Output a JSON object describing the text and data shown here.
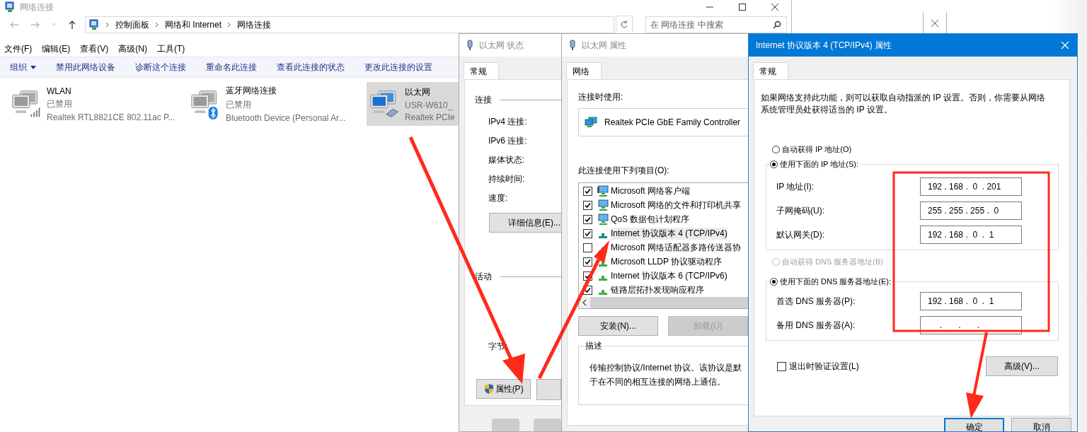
{
  "explorer": {
    "title": "网络连接",
    "breadcrumb": [
      "控制面板",
      "网络和 Internet",
      "网络连接"
    ],
    "search": {
      "placeholder": "在 网络连接 中搜索"
    },
    "menu": [
      "文件(F)",
      "编辑(E)",
      "查看(V)",
      "高级(N)",
      "工具(T)"
    ],
    "commands": [
      {
        "label": "组织",
        "kind": "menu"
      },
      {
        "label": "禁用此网络设备",
        "kind": "command"
      },
      {
        "label": "诊断这个连接",
        "kind": "command"
      },
      {
        "label": "重命名此连接",
        "kind": "command"
      },
      {
        "label": "查看此连接的状态",
        "kind": "command"
      },
      {
        "label": "更改此连接的设置",
        "kind": "command"
      }
    ],
    "connections": [
      {
        "name": "WLAN",
        "status": "已禁用",
        "device": "Realtek RTL8821CE 802.11ac P...",
        "kind": "wifi",
        "selected": false
      },
      {
        "name": "蓝牙网络连接",
        "status": "已禁用",
        "device": "Bluetooth Device (Personal Ar...",
        "kind": "bluetooth",
        "selected": false
      },
      {
        "name": "以太网",
        "status": "USR-W610_",
        "device": "Realtek PCIe",
        "kind": "ethernet",
        "selected": true
      }
    ]
  },
  "status_dialog": {
    "title": "以太网 状态",
    "tabs": [
      {
        "label": "常规",
        "selected": true
      }
    ],
    "connection_group": "连接",
    "fields": [
      "IPv4 连接:",
      "IPv6 连接:",
      "媒体状态:",
      "持续时间:",
      "速度:"
    ],
    "details_button": "详细信息(E)...",
    "activity_group": "活动",
    "bytes_label": "字节:",
    "properties_button": "属性(P)"
  },
  "properties_dialog": {
    "title": "以太网 属性",
    "tabs": [
      {
        "label": "网络",
        "selected": true
      }
    ],
    "connect_using_label": "连接时使用:",
    "adapter": "Realtek PCIe GbE Family Controller",
    "items_label": "此连接使用下列项目(O):",
    "items": [
      {
        "label": "Microsoft 网络客户端",
        "kind": "client",
        "checked": true,
        "selected": false
      },
      {
        "label": "Microsoft 网络的文件和打印机共享",
        "kind": "service",
        "checked": true,
        "selected": false
      },
      {
        "label": "QoS 数据包计划程序",
        "kind": "service",
        "checked": true,
        "selected": false
      },
      {
        "label": "Internet 协议版本 4 (TCP/IPv4)",
        "kind": "protocol",
        "checked": true,
        "selected": true
      },
      {
        "label": "Microsoft 网络适配器多路传送器协",
        "kind": "protocol",
        "checked": false,
        "selected": false
      },
      {
        "label": "Microsoft LLDP 协议驱动程序",
        "kind": "protocol",
        "checked": true,
        "selected": false
      },
      {
        "label": "Internet 协议版本 6 (TCP/IPv6)",
        "kind": "protocol",
        "checked": true,
        "selected": false
      },
      {
        "label": "链路层拓扑发现响应程序",
        "kind": "protocol",
        "checked": true,
        "selected": false
      }
    ],
    "install_button": {
      "label": "安装(N)...",
      "disabled": false
    },
    "uninstall_button": {
      "label": "卸载(U)",
      "disabled": true
    },
    "description_group": "描述",
    "description_lines": [
      "传输控制协议/Internet 协议。该协议是默",
      "于在不同的相互连接的网络上通信。"
    ]
  },
  "ipv4_dialog": {
    "title": "Internet 协议版本 4 (TCP/IPv4) 属性",
    "tabs": [
      {
        "label": "常规",
        "selected": true
      }
    ],
    "intro": "如果网络支持此功能，则可以获取自动指派的 IP 设置。否则，你需要从网络系统管理员处获得适当的 IP 设置。",
    "ip_auto": {
      "label": "自动获得 IP 地址(O)",
      "selected": false,
      "disabled": false
    },
    "ip_manual": {
      "label": "使用下面的 IP 地址(S):",
      "selected": true,
      "disabled": false
    },
    "ip_fields": [
      {
        "label": "IP 地址(I):",
        "value": "192 . 168 .  0  . 201"
      },
      {
        "label": "子网掩码(U):",
        "value": "255 . 255 . 255 .  0"
      },
      {
        "label": "默认网关(D):",
        "value": "192 . 168 .  0  .  1"
      }
    ],
    "dns_auto": {
      "label": "自动获得 DNS 服务器地址(B)",
      "selected": false,
      "disabled": true
    },
    "dns_manual": {
      "label": "使用下面的 DNS 服务器地址(E):",
      "selected": true,
      "disabled": false
    },
    "dns_fields": [
      {
        "label": "首选 DNS 服务器(P):",
        "value": "192 . 168 .  0  .  1"
      },
      {
        "label": "备用 DNS 服务器(A):",
        "value": "     .       .       ."
      }
    ],
    "validate": {
      "label": "退出时验证设置(L)",
      "checked": false
    },
    "advanced_button": "高级(V)...",
    "ok_button": "确定",
    "cancel_button": "取消"
  }
}
